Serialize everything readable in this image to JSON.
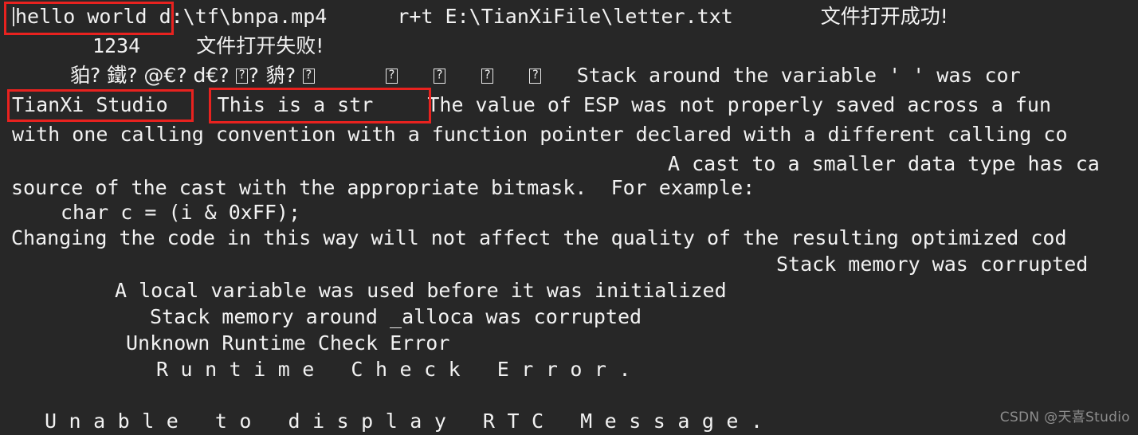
{
  "console": {
    "background_color": "#272727",
    "text_color": "#f2f2f2",
    "annotation_color": "#e8221f",
    "lines": {
      "l1_a": "hello world d:\\tf\\bnpa.mp4",
      "l1_b": "r+t E:\\TianXiFile\\letter.txt",
      "l1_c": "文件打开成功!",
      "l2_a": "1234",
      "l2_b": "文件打开失败!",
      "l3_a": "貃? 鐵? @€? d€? ",
      "l3_b": "? 貈? ",
      "l3_c": "Stack around the variable ' ' was cor",
      "l4_a": "TianXi Studio",
      "l4_b": "This is a str",
      "l4_c": "The value of ESP was not properly saved across a fun",
      "l5": "with one calling convention with a function pointer declared with a different calling co",
      "l6": "A cast to a smaller data type has ca",
      "l7": "source of the cast with the appropriate bitmask.  For example:",
      "l8": "char c = (i & 0xFF);",
      "l9": "Changing the code in this way will not affect the quality of the resulting optimized cod",
      "l10": "Stack memory was corrupted",
      "l11": "A local variable was used before it was initialized",
      "l12": "Stack memory around _alloca was corrupted",
      "l13": "Unknown Runtime Check Error",
      "l14": "Runtime Check Error.",
      "l15": "Unable to display RTC Message."
    }
  },
  "annotations": {
    "box1_label": "hello-world-output-highlight",
    "box2_label": "tianxi-studio-output-highlight",
    "box3_label": "this-is-a-str-output-highlight"
  },
  "watermark": {
    "text": "CSDN @天喜Studio"
  }
}
